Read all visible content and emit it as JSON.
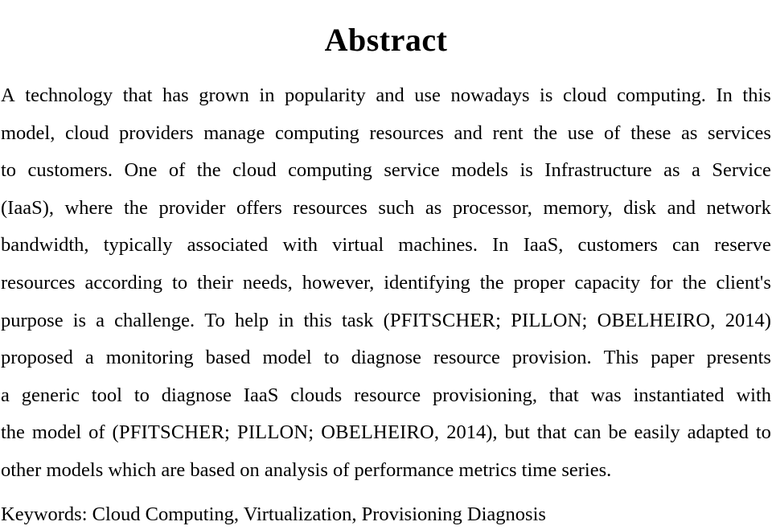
{
  "document": {
    "heading": "Abstract",
    "abstract_full_text": "A technology that has grown in popularity and use nowadays is cloud computing. In this model, cloud providers manage computing resources and rent the use of these as services to customers. One of the cloud computing service models is Infrastructure as a Service (IaaS), where the provider offers resources such as processor, memory, disk and network bandwidth, typically associated with virtual machines. In IaaS, customers can reserve resources according to their needs, however, identifying the proper capacity for the client's purpose is a challenge. To help in this task (PFITSCHER; PILLON; OBELHEIRO, 2014) proposed a monitoring based model to diagnose resource provision. This paper presents a generic tool to diagnose IaaS clouds resource provisioning, that was instantiated with the model of (PFITSCHER; PILLON; OBELHEIRO, 2014), but that can be easily adapted to other models which are based on analysis of performance metrics time series.",
    "lines": [
      {
        "id": "line-1",
        "align": "justify",
        "words": [
          "A",
          "technology",
          "that",
          "has",
          "grown",
          "in",
          "popularity",
          "and",
          "use",
          "nowadays",
          "is",
          "cloud",
          "computing.",
          "In",
          "this"
        ]
      },
      {
        "id": "line-2",
        "align": "justify",
        "words": [
          "model,",
          "cloud",
          "providers",
          "manage",
          "computing",
          "resources",
          "and",
          "rent",
          "the",
          "use",
          "of",
          "these",
          "as",
          "services"
        ]
      },
      {
        "id": "line-3",
        "align": "justify",
        "words": [
          "to",
          "customers.",
          "One",
          "of",
          "the",
          "cloud",
          "computing",
          "service",
          "models",
          "is",
          "Infrastructure",
          "as",
          "a",
          "Service"
        ]
      },
      {
        "id": "line-4",
        "align": "justify",
        "words": [
          "(IaaS),",
          "where",
          "the",
          "provider",
          "offers",
          "resources",
          "such",
          "as",
          "processor,",
          "memory,",
          "disk",
          "and",
          "network"
        ]
      },
      {
        "id": "line-5",
        "align": "justify",
        "words": [
          "bandwidth,",
          "typically",
          "associated",
          "with",
          "virtual",
          "machines.",
          "In",
          "IaaS,",
          "customers",
          "can",
          "reserve"
        ]
      },
      {
        "id": "line-6",
        "align": "justify",
        "words": [
          "resources",
          "according",
          "to",
          "their",
          "needs,",
          "however,",
          "identifying",
          "the",
          "proper",
          "capacity",
          "for",
          "the",
          "client's"
        ]
      },
      {
        "id": "line-7",
        "align": "justify",
        "words": [
          "purpose",
          "is",
          "a",
          "challenge.",
          "To",
          "help",
          "in",
          "this",
          "task",
          "(PFITSCHER;",
          "PILLON;",
          "OBELHEIRO,",
          "2014)"
        ],
        "smallcaps_words": [
          9,
          10,
          11
        ]
      },
      {
        "id": "line-8",
        "align": "justify",
        "words": [
          "proposed",
          "a",
          "monitoring",
          "based",
          "model",
          "to",
          "diagnose",
          "resource",
          "provision.",
          "This",
          "paper",
          "presents"
        ]
      },
      {
        "id": "line-9",
        "align": "justify",
        "words": [
          "a",
          "generic",
          "tool",
          "to",
          "diagnose",
          "IaaS",
          "clouds",
          "resource",
          "provisioning,",
          "that",
          "was",
          "instantiated",
          "with"
        ]
      },
      {
        "id": "line-10",
        "align": "justify",
        "words": [
          "the",
          "model",
          "of",
          "(PFITSCHER;",
          "PILLON;",
          "OBELHEIRO,",
          "2014),",
          "but",
          "that",
          "can",
          "be",
          "easily",
          "adapted",
          "to"
        ],
        "smallcaps_words": [
          3,
          4,
          5
        ]
      },
      {
        "id": "line-11",
        "align": "flush",
        "words": [
          "other models which are based on analysis of performance metrics time series."
        ]
      }
    ],
    "keywords_line": "Keywords: Cloud Computing, Virtualization, Provisioning Diagnosis",
    "citation_1": "(PFITSCHER; PILLON; OBELHEIRO, 2014)",
    "citation_2": "(PFITSCHER; PILLON; OBELHEIRO, 2014)",
    "colors": {
      "page_background": "#ffffff",
      "text": "#000000"
    }
  }
}
